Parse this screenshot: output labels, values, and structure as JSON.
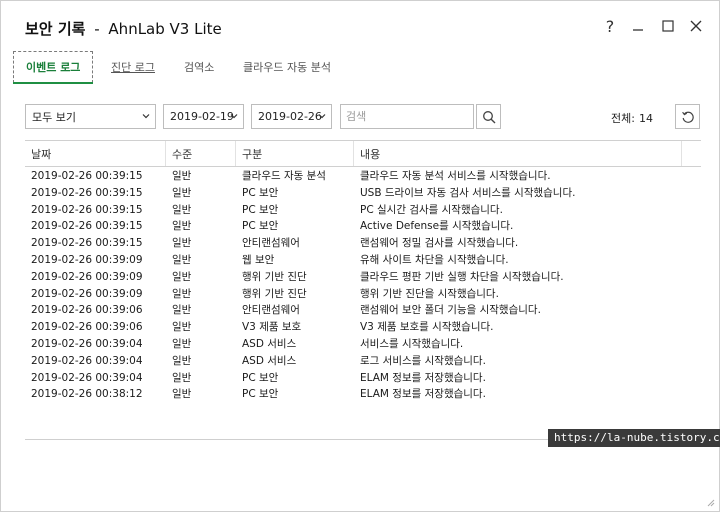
{
  "window": {
    "title_bold": "보안 기록",
    "title_sep": "-",
    "title_app": "AhnLab V3 Lite",
    "help_label": "?"
  },
  "tabs": [
    {
      "label": "이벤트 로그",
      "active": true
    },
    {
      "label": "진단 로그",
      "active": false
    },
    {
      "label": "검역소",
      "active": false
    },
    {
      "label": "클라우드 자동 분석",
      "active": false
    }
  ],
  "toolbar": {
    "filter_value": "모두 보기",
    "date_from": "2019-02-19",
    "date_to": "2019-02-26",
    "search_placeholder": "검색",
    "total_label": "전체:",
    "total_count": "14"
  },
  "table": {
    "columns": [
      "날짜",
      "수준",
      "구분",
      "내용"
    ],
    "rows": [
      [
        "2019-02-26 00:39:15",
        "일반",
        "클라우드 자동 분석",
        "클라우드 자동 분석 서비스를 시작했습니다."
      ],
      [
        "2019-02-26 00:39:15",
        "일반",
        "PC 보안",
        "USB 드라이브 자동 검사 서비스를 시작했습니다."
      ],
      [
        "2019-02-26 00:39:15",
        "일반",
        "PC 보안",
        "PC 실시간 검사를 시작했습니다."
      ],
      [
        "2019-02-26 00:39:15",
        "일반",
        "PC 보안",
        "Active Defense를 시작했습니다."
      ],
      [
        "2019-02-26 00:39:15",
        "일반",
        "안티랜섬웨어",
        "랜섬웨어 정밀 검사를 시작했습니다."
      ],
      [
        "2019-02-26 00:39:09",
        "일반",
        "웹 보안",
        "유해 사이트 차단을 시작했습니다."
      ],
      [
        "2019-02-26 00:39:09",
        "일반",
        "행위 기반 진단",
        "클라우드 평판 기반 실행 차단을 시작했습니다."
      ],
      [
        "2019-02-26 00:39:09",
        "일반",
        "행위 기반 진단",
        "행위 기반 진단을 시작했습니다."
      ],
      [
        "2019-02-26 00:39:06",
        "일반",
        "안티랜섬웨어",
        "랜섬웨어 보안 폴더 기능을 시작했습니다."
      ],
      [
        "2019-02-26 00:39:06",
        "일반",
        "V3 제품 보호",
        "V3 제품 보호를 시작했습니다."
      ],
      [
        "2019-02-26 00:39:04",
        "일반",
        "ASD 서비스",
        "서비스를 시작했습니다."
      ],
      [
        "2019-02-26 00:39:04",
        "일반",
        "ASD 서비스",
        "로그 서비스를 시작했습니다."
      ],
      [
        "2019-02-26 00:39:04",
        "일반",
        "PC 보안",
        "ELAM 정보를 저장했습니다."
      ],
      [
        "2019-02-26 00:38:12",
        "일반",
        "PC 보안",
        "ELAM 정보를 저장했습니다."
      ]
    ]
  },
  "watermark": "https://la-nube.tistory.com",
  "colors": {
    "accent": "#1f8f43",
    "border": "#bdbdbd"
  }
}
